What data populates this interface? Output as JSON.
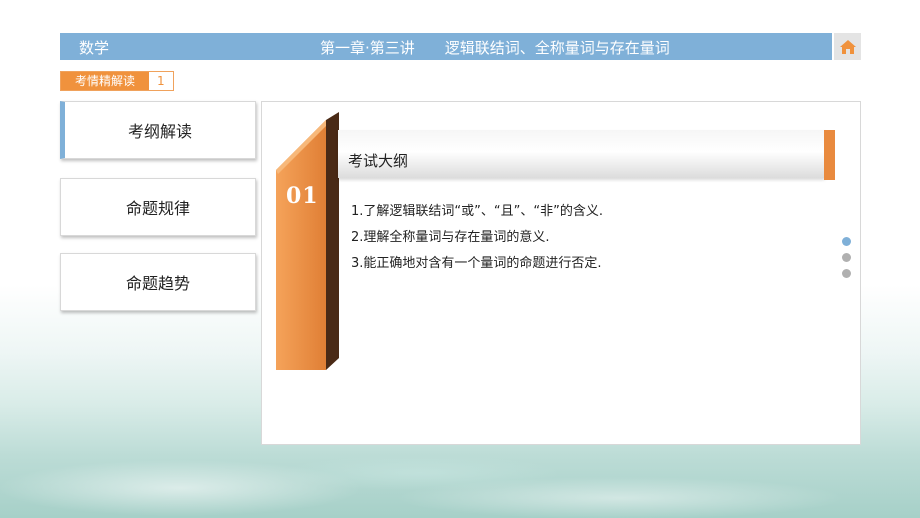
{
  "header": {
    "subject": "数学",
    "chapter": "第一章·第三讲　　逻辑联结词、全称量词与存在量词",
    "home_icon": "home-icon"
  },
  "breadcrumb": {
    "label": "考情精解读",
    "number": "1"
  },
  "sidebar": {
    "items": [
      {
        "label": "考纲解读",
        "active": true
      },
      {
        "label": "命题规律",
        "active": false
      },
      {
        "label": "命题趋势",
        "active": false
      }
    ]
  },
  "content": {
    "section_number": "01",
    "section_title": "考试大纲",
    "lines": [
      "1.了解逻辑联结词“或”、“且”、“非”的含义.",
      "2.理解全称量词与存在量词的意义.",
      "3.能正确地对含有一个量词的命题进行否定."
    ]
  },
  "pagination": {
    "total": 3,
    "current": 1
  },
  "colors": {
    "accent_blue": "#7fb0d8",
    "accent_orange": "#f0923d",
    "dark_orange": "#c9682a"
  }
}
